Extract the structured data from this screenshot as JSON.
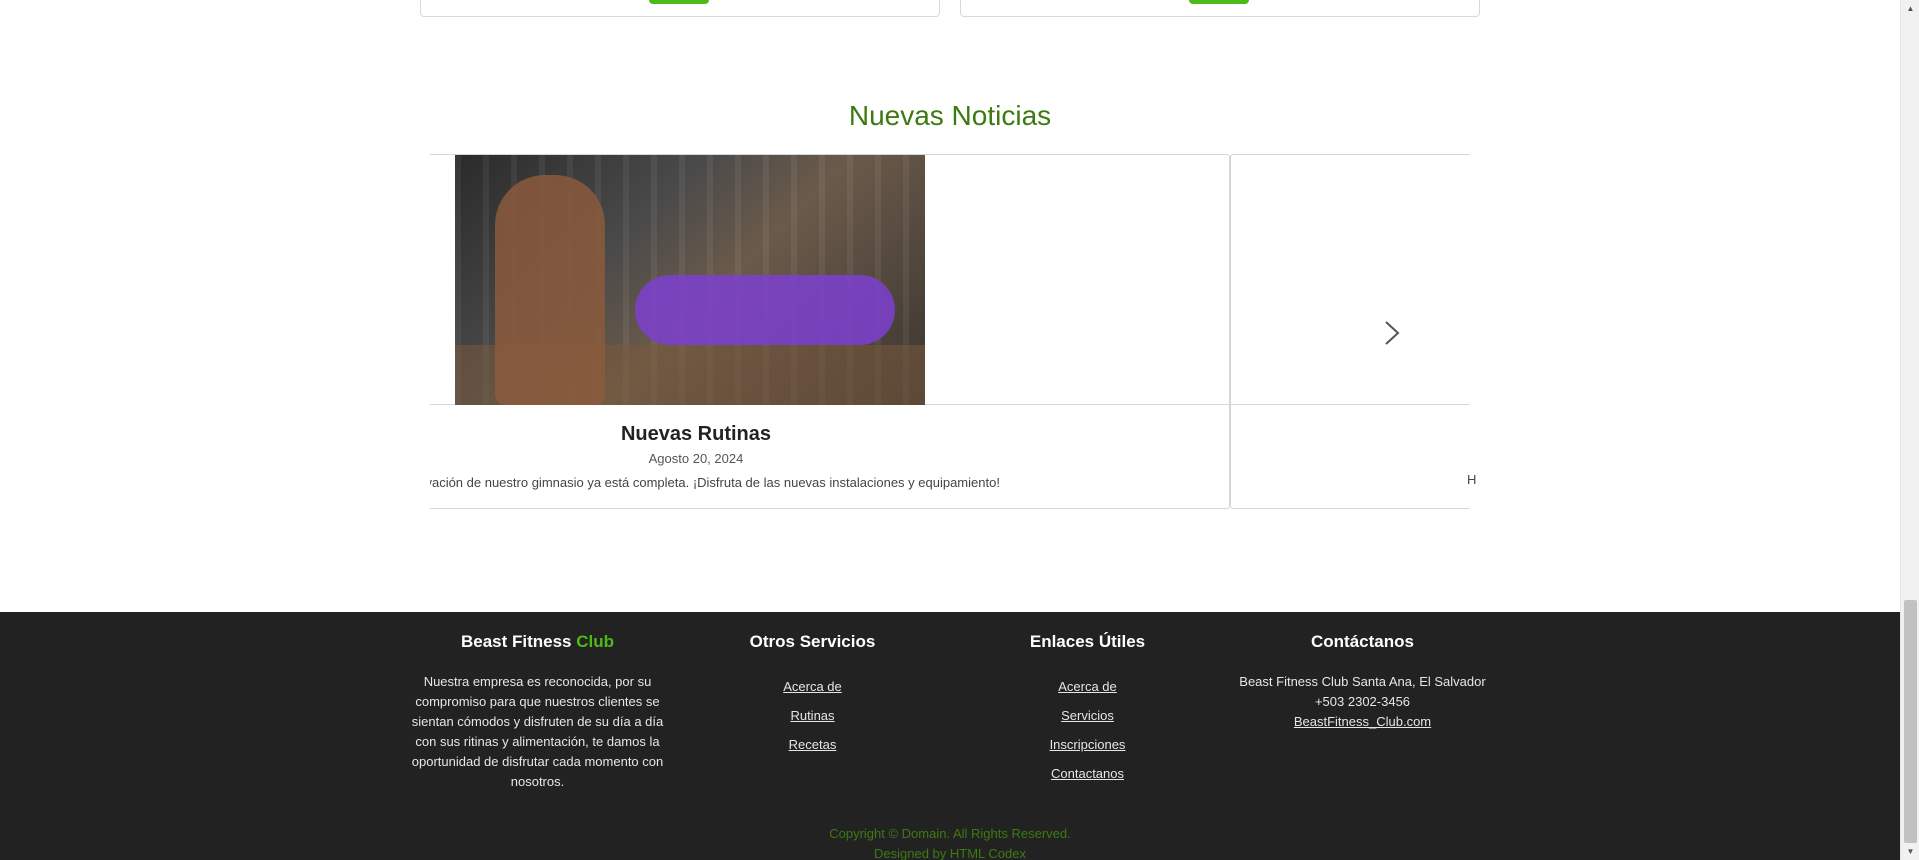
{
  "news_section": {
    "title": "Nuevas Noticias",
    "cards": [
      {
        "title": "Nuevas Rutinas",
        "date": "Agosto 20, 2024",
        "text": "novación de nuestro gimnasio ya está completa. ¡Disfruta de las nuevas instalaciones y equipamiento!"
      }
    ],
    "next_fragment": "H",
    "next_icon": "chevron-right-icon"
  },
  "footer": {
    "about": {
      "title_main": "Beast Fitness ",
      "title_accent": "Club",
      "text": "Nuestra empresa es reconocida, por su compromiso para que nuestros clientes se sientan cómodos y disfruten de su día a día con sus ritinas y alimentación, te damos la oportunidad de disfrutar cada momento con nosotros."
    },
    "services": {
      "title": "Otros Servicios",
      "links": [
        "Acerca de",
        "Rutinas",
        "Recetas"
      ]
    },
    "useful_links": {
      "title": "Enlaces Útiles",
      "links": [
        "Acerca de",
        "Servicios",
        "Inscripciones",
        "Contactanos"
      ]
    },
    "contact": {
      "title": "Contáctanos",
      "address": "Beast Fitness Club Santa Ana, El Salvador",
      "phone": "+503 2302-3456",
      "website": "BeastFitness_Club.com"
    },
    "copyright": "Copyright © Domain. All Rights Reserved.",
    "designed_by": "Designed by HTML Codex"
  },
  "colors": {
    "accent_green": "#4cbb17",
    "title_green": "#3d7a12",
    "footer_bg": "#222222"
  }
}
